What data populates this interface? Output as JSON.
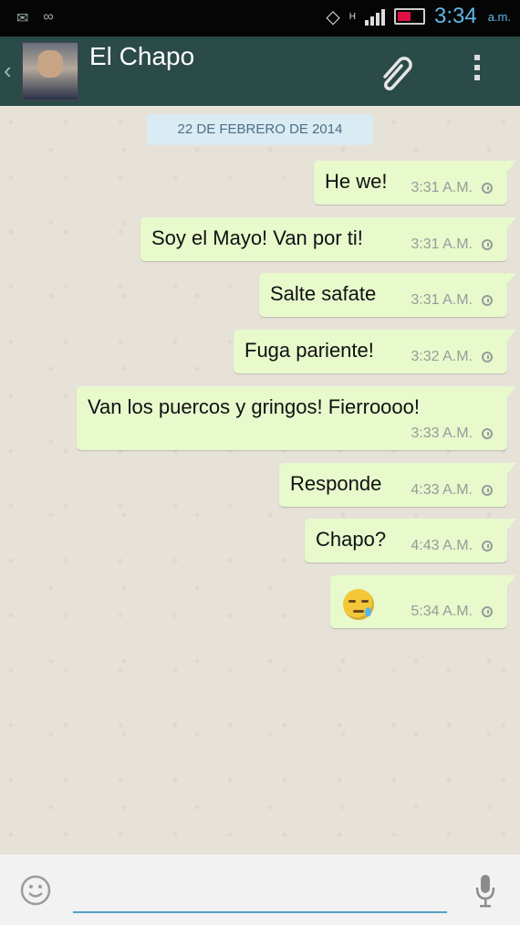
{
  "status_bar": {
    "time": "3:34",
    "ampm": "a.m.",
    "network_type": "H"
  },
  "header": {
    "contact_name": "El Chapo",
    "icons": [
      "back-icon",
      "avatar",
      "paperclip-icon",
      "overflow-menu-icon"
    ]
  },
  "chat": {
    "date_label": "22 DE FEBRERO DE 2014",
    "messages": [
      {
        "text": "He we!",
        "time": "3:31 A.M."
      },
      {
        "text": "Soy el Mayo! Van por ti!",
        "time": "3:31 A.M."
      },
      {
        "text": "Salte safate",
        "time": "3:31 A.M."
      },
      {
        "text": "Fuga pariente!",
        "time": "3:32 A.M."
      },
      {
        "text": "Van los puercos y gringos! Fierroooo!",
        "time": "3:33 A.M."
      },
      {
        "text": "Responde",
        "time": "4:33 A.M."
      },
      {
        "text": "Chapo?",
        "time": "4:43 A.M."
      },
      {
        "text": "",
        "time": "5:34 A.M.",
        "emoji": "crying-face"
      }
    ]
  },
  "input_bar": {
    "placeholder": "",
    "icons": [
      "smiley-icon",
      "microphone-icon"
    ]
  },
  "colors": {
    "header": "#2a4b48",
    "outgoing_bubble": "#e8f9cc",
    "date_chip": "#d9ebf3",
    "accent": "#4fa1c9"
  }
}
